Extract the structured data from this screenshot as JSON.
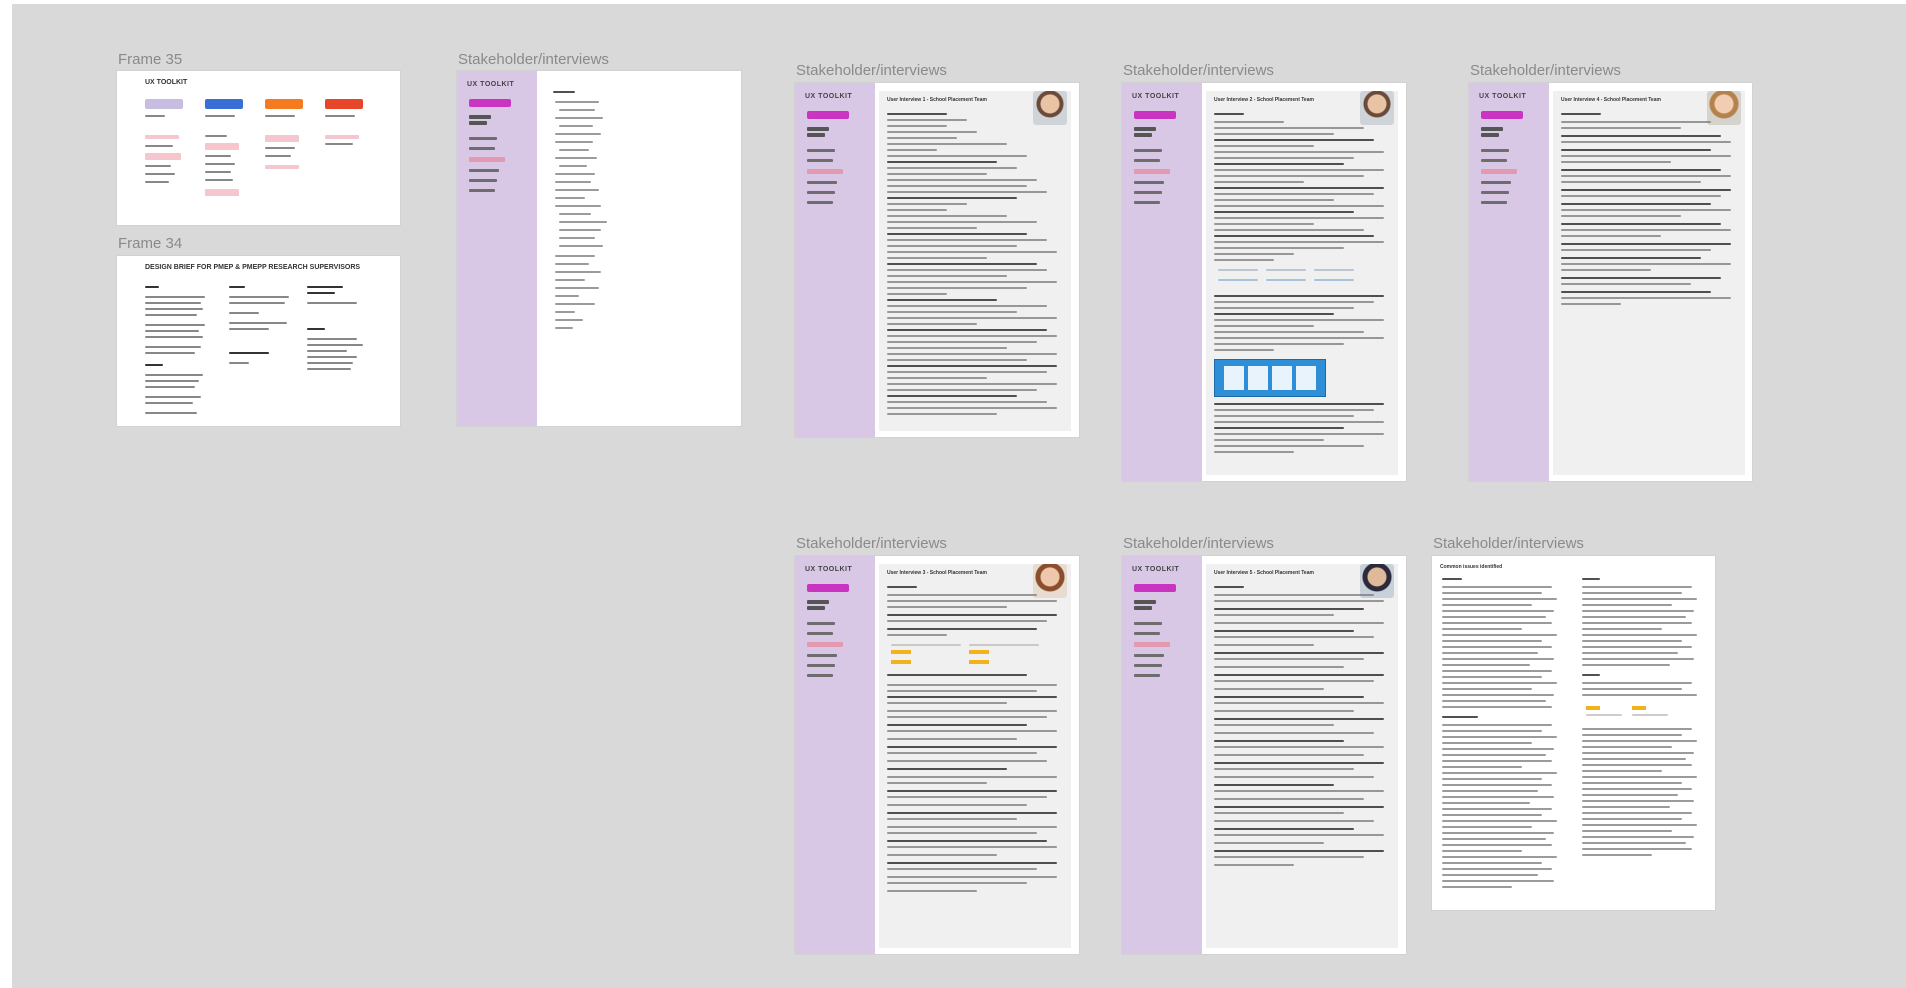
{
  "frames": {
    "frame35": {
      "label": "Frame 35",
      "title": "UX TOOLKIT"
    },
    "frame34": {
      "label": "Frame 34",
      "title": "DESIGN BRIEF FOR PMEP & PMEPP RESEARCH SUPERVISORS"
    },
    "stakeholder_label": "Stakeholder/interviews",
    "toolkit": "UX TOOLKIT",
    "interview1": "User Interview 1 - School Placement Team",
    "interview2": "User Interview 2 - School Placement Team",
    "interview4": "User Interview 4 - School Placement Team",
    "interview3": "User Interview 3 - School Placement Team",
    "interview5": "User Interview 5 - School Placement Team",
    "common_issues": "Common issues identified"
  },
  "colors": {
    "canvas": "#d9d9d9",
    "sidebar": "#d8c8e6",
    "magenta": "#c934c0",
    "orange": "#f47b20",
    "blue": "#2f8fd6",
    "yellow": "#f2b21b"
  }
}
